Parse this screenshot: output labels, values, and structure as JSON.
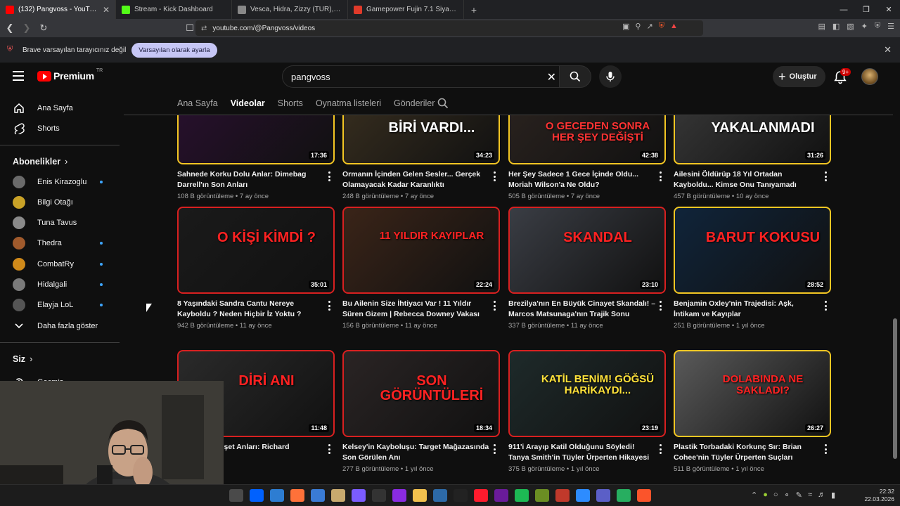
{
  "browser": {
    "tabs": [
      {
        "title": "(132) Pangvoss - YouTube",
        "icon": "youtube-icon",
        "color": "#ff0000",
        "active": true
      },
      {
        "title": "Stream - Kick Dashboard",
        "icon": "kick-icon",
        "color": "#53fc18",
        "active": false
      },
      {
        "title": "Vesca, Hidra, Zizzy (TUR), aspi, Harim",
        "icon": "page-icon",
        "color": "#888888",
        "active": false
      },
      {
        "title": "Gamepower Fujin 7.1 Siyah Surround",
        "icon": "gamepower-icon",
        "color": "#e03a2a",
        "active": false
      }
    ],
    "url": "youtube.com/@Pangvoss/videos",
    "infobar_text": "Brave varsayılan tarayıcınız değil",
    "infobar_button": "Varsayılan olarak ayarla"
  },
  "youtube": {
    "logo_text": "Premium",
    "logo_region": "TR",
    "search_value": "pangvoss",
    "create_label": "Oluştur",
    "notification_badge": "9+",
    "sidebar": {
      "main": [
        {
          "label": "Ana Sayfa",
          "icon": "home-icon"
        },
        {
          "label": "Shorts",
          "icon": "shorts-icon"
        }
      ],
      "subs_heading": "Abonelikler",
      "subs": [
        {
          "label": "Enis Kirazoglu",
          "color": "#6a6a6a",
          "live": true
        },
        {
          "label": "Bilgi Otağı",
          "color": "#c9a227",
          "live": false
        },
        {
          "label": "Tuna Tavus",
          "color": "#8a8a8a",
          "live": false
        },
        {
          "label": "Thedra",
          "color": "#a05a2c",
          "live": true
        },
        {
          "label": "CombatRy",
          "color": "#d08a1a",
          "live": true
        },
        {
          "label": "Hidalgali",
          "color": "#7a7a7a",
          "live": true
        },
        {
          "label": "Elayja LoL",
          "color": "#555555",
          "live": true
        }
      ],
      "show_more": "Daha fazla göster",
      "you_heading": "Siz",
      "history_label": "Geçmiş"
    },
    "channel_tabs": [
      {
        "label": "Ana Sayfa",
        "selected": false
      },
      {
        "label": "Videolar",
        "selected": true
      },
      {
        "label": "Shorts",
        "selected": false
      },
      {
        "label": "Oynatma listeleri",
        "selected": false
      },
      {
        "label": "Gönderiler",
        "selected": false
      }
    ],
    "videos": [
      {
        "title": "Sahnede Korku Dolu Anlar: Dimebag Darrell'ın Son Anları",
        "views": "108 B görüntüleme",
        "age": "7 ay önce",
        "duration": "17:36",
        "border": "yellow",
        "bg": "#2a1030",
        "thumb_text": "",
        "thumb_accent": "#c0123a"
      },
      {
        "title": "Ormanın İçinden Gelen Sesler... Gerçek Olamayacak Kadar Karanlıktı",
        "views": "248 B görüntüleme",
        "age": "7 ay önce",
        "duration": "34:23",
        "border": "yellow",
        "bg": "#3a3020",
        "thumb_text": "BİRİ VARDI...",
        "thumb_accent": "#ffffff"
      },
      {
        "title": "Her Şey Sadece 1 Gece İçinde Oldu... Moriah Wilson'a Ne Oldu?",
        "views": "505 B görüntüleme",
        "age": "7 ay önce",
        "duration": "42:38",
        "border": "yellow",
        "bg": "#2c2420",
        "thumb_text": "O GECEDEN SONRA HER ŞEY DEĞİŞTİ",
        "thumb_accent": "#ff3333"
      },
      {
        "title": "Ailesini Öldürüp 18 Yıl Ortadan Kayboldu... Kimse Onu Tanıyamadı",
        "views": "457 B görüntüleme",
        "age": "10 ay önce",
        "duration": "31:26",
        "border": "yellow",
        "bg": "#3a3a3a",
        "thumb_text": "YAKALANMADI",
        "thumb_accent": "#ffffff"
      },
      {
        "title": "8 Yaşındaki Sandra Cantu Nereye Kayboldu ? Neden Hiçbir İz Yoktu ?",
        "views": "942 B görüntüleme",
        "age": "11 ay önce",
        "duration": "35:01",
        "border": "red",
        "bg": "#1a1a1a",
        "thumb_text": "O KİŞİ KİMDİ ?",
        "thumb_accent": "#ff2222"
      },
      {
        "title": "Bu Ailenin Size İhtiyacı Var ! 11 Yıldır Süren Gizem | Rebecca Downey Vakası",
        "views": "156 B görüntüleme",
        "age": "11 ay önce",
        "duration": "22:24",
        "border": "red",
        "bg": "#3a2418",
        "thumb_text": "11 YILDIR KAYIPLAR",
        "thumb_accent": "#ff2222"
      },
      {
        "title": "Brezilya'nın En Büyük Cinayet Skandalı! – Marcos Matsunaga'nın Trajik Sonu",
        "views": "337 B görüntüleme",
        "age": "11 ay önce",
        "duration": "23:10",
        "border": "red",
        "bg": "#3a3d44",
        "thumb_text": "SKANDAL",
        "thumb_accent": "#ff2222"
      },
      {
        "title": "Benjamin Oxley'nin Trajedisi: Aşk, İntikam ve Kayıplar",
        "views": "251 B görüntüleme",
        "age": "1 yıl önce",
        "duration": "28:52",
        "border": "yellow",
        "bg": "#10243a",
        "thumb_text": "BARUT KOKUSU",
        "thumb_accent": "#ff2222"
      },
      {
        "title": "Sahnede Dehşet Anları: Richard",
        "views": "",
        "age": "1 yıl önce",
        "duration": "11:48",
        "border": "red",
        "bg": "#2a2a2a",
        "thumb_text": "DİRİ ANI",
        "thumb_accent": "#ff2222"
      },
      {
        "title": "Kelsey'in Kayboluşu: Target Mağazasında Son Görülen Anı",
        "views": "277 B görüntüleme",
        "age": "1 yıl önce",
        "duration": "18:34",
        "border": "red",
        "bg": "#2a2424",
        "thumb_text": "SON GÖRÜNTÜLERİ",
        "thumb_accent": "#ff2222"
      },
      {
        "title": "911'i Arayıp Katil Olduğunu Söyledi! Tanya Smith'in Tüyler Ürperten Hikayesi",
        "views": "375 B görüntüleme",
        "age": "1 yıl önce",
        "duration": "23:19",
        "border": "red",
        "bg": "#1e2a2a",
        "thumb_text": "KATİL BENİM! GÖĞSÜ HARİKAYDI...",
        "thumb_accent": "#ffe23a"
      },
      {
        "title": "Plastik Torbadaki Korkunç Sır: Brian Cohee'nin Tüyler Ürperten Suçları",
        "views": "511 B görüntüleme",
        "age": "1 yıl önce",
        "duration": "26:27",
        "border": "yellow",
        "bg": "#5a5a5a",
        "thumb_text": "DOLABINDA NE SAKLADI?",
        "thumb_accent": "#ff2222"
      }
    ]
  },
  "taskbar": {
    "time": "22:32",
    "date": "22.03.2026"
  }
}
